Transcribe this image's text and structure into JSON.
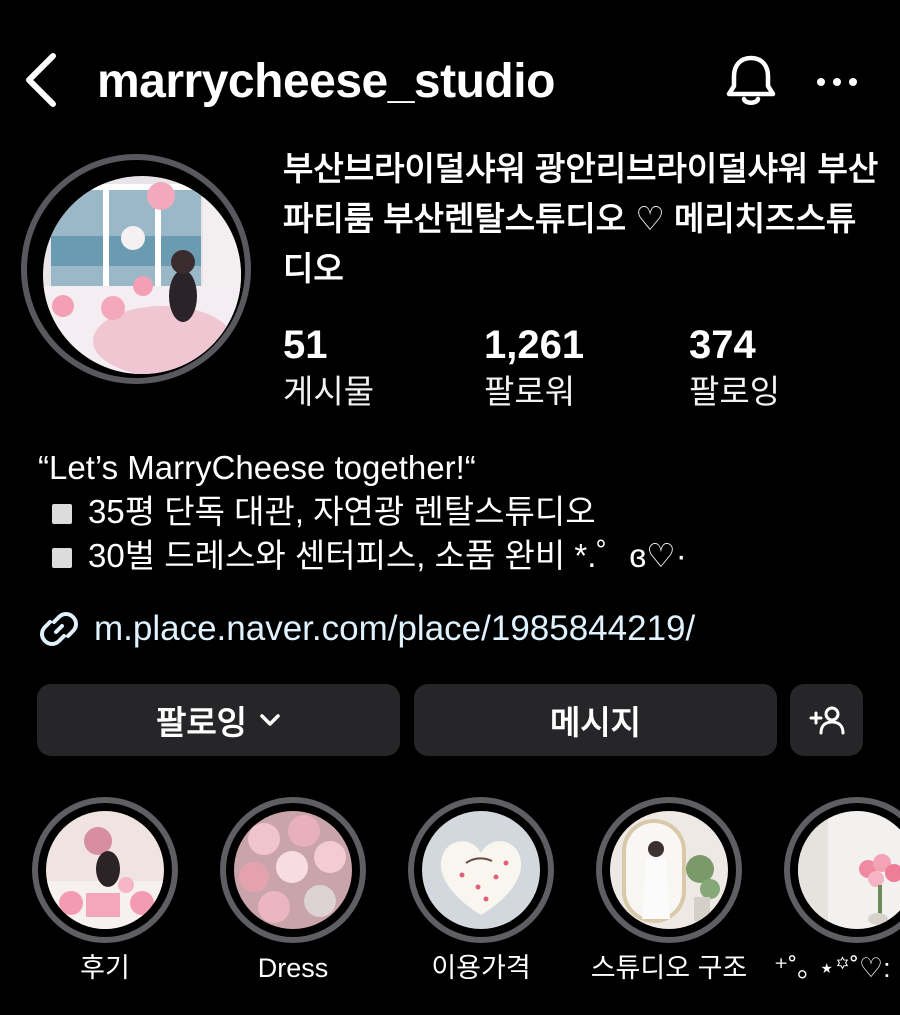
{
  "header": {
    "username": "marrycheese_studio",
    "back_icon": "chevron-left-icon",
    "bell_icon": "bell-icon",
    "more_icon": "more-horizontal-icon"
  },
  "profile": {
    "full_name": "부산브라이덜샤워 광안리브라이덜샤워 부산파티룸 부산렌탈스튜디오 ♡ 메리치즈스튜디오",
    "stats": [
      {
        "value": "51",
        "label": "게시물"
      },
      {
        "value": "1,261",
        "label": "팔로워"
      },
      {
        "value": "374",
        "label": "팔로잉"
      }
    ],
    "bio": {
      "line1": "“Let’s MarryCheese together!“",
      "line2": "35평 단독 대관, 자연광 렌탈스튜디오",
      "line3": "30벌 드레스와 센터피스, 소품 완비 *.゜ɞ♡·"
    },
    "link": "m.place.naver.com/place/1985844219/"
  },
  "actions": {
    "follow_label": "팔로잉",
    "message_label": "메시지",
    "add_icon": "add-person-icon"
  },
  "highlights": [
    {
      "label": "후기"
    },
    {
      "label": "Dress"
    },
    {
      "label": "이용가격"
    },
    {
      "label": "스튜디오 구조"
    },
    {
      "label": "⁺˚｡ ⋆꙳˚♡:"
    }
  ],
  "colors": {
    "background": "#000000",
    "button": "#262629",
    "ring": "#58585e",
    "link": "#e0f1ff"
  }
}
